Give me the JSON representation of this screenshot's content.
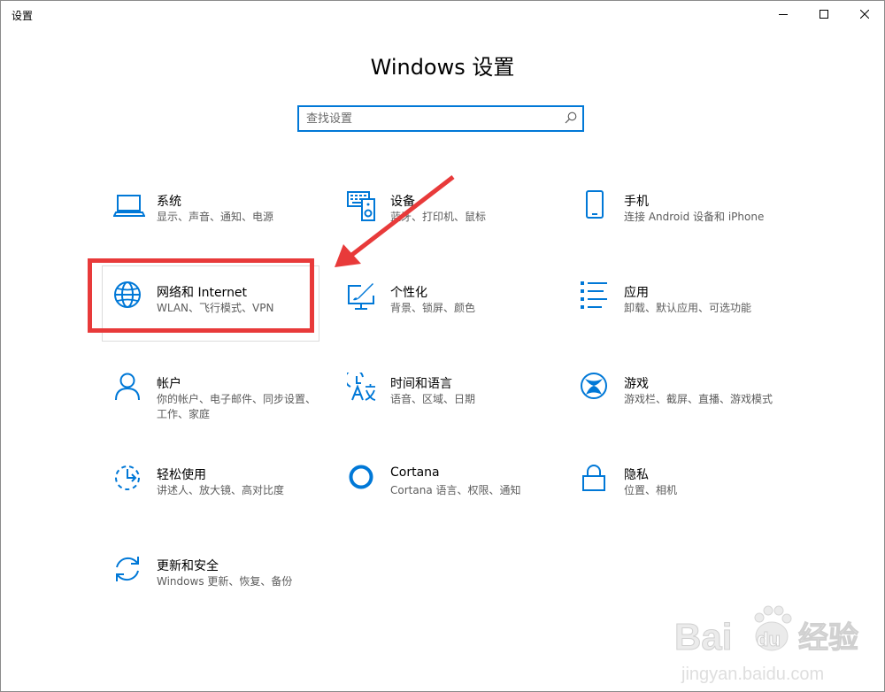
{
  "window": {
    "title": "设置",
    "controls": {
      "minimize": "minimize-icon",
      "maximize": "maximize-icon",
      "close": "close-icon"
    }
  },
  "header": {
    "title": "Windows 设置"
  },
  "search": {
    "placeholder": "查找设置",
    "icon": "search-icon"
  },
  "categories": [
    {
      "name": "系统",
      "desc": "显示、声音、通知、电源",
      "icon": "laptop-icon"
    },
    {
      "name": "设备",
      "desc": "蓝牙、打印机、鼠标",
      "icon": "keyboard-devices-icon"
    },
    {
      "name": "手机",
      "desc": "连接 Android 设备和 iPhone",
      "icon": "phone-icon"
    },
    {
      "name": "网络和 Internet",
      "desc": "WLAN、飞行模式、VPN",
      "icon": "globe-icon"
    },
    {
      "name": "个性化",
      "desc": "背景、锁屏、颜色",
      "icon": "paint-monitor-icon"
    },
    {
      "name": "应用",
      "desc": "卸载、默认应用、可选功能",
      "icon": "apps-list-icon"
    },
    {
      "name": "帐户",
      "desc": "你的帐户、电子邮件、同步设置、工作、家庭",
      "icon": "person-icon"
    },
    {
      "name": "时间和语言",
      "desc": "语音、区域、日期",
      "icon": "time-language-icon"
    },
    {
      "name": "游戏",
      "desc": "游戏栏、截屏、直播、游戏模式",
      "icon": "xbox-icon"
    },
    {
      "name": "轻松使用",
      "desc": "讲述人、放大镜、高对比度",
      "icon": "ease-of-access-icon"
    },
    {
      "name": "Cortana",
      "desc": "Cortana 语言、权限、通知",
      "icon": "cortana-icon"
    },
    {
      "name": "隐私",
      "desc": "位置、相机",
      "icon": "lock-icon"
    },
    {
      "name": "更新和安全",
      "desc": "Windows 更新、恢复、备份",
      "icon": "sync-icon"
    }
  ],
  "annotation": {
    "highlight_color": "#e83a3a",
    "target": "网络和 Internet"
  },
  "watermark": {
    "brand": "Bai",
    "paw": "du",
    "cn": "经验",
    "url": "jingyan.baidu.com"
  },
  "colors": {
    "accent": "#0078d7",
    "annotation": "#e83a3a"
  }
}
